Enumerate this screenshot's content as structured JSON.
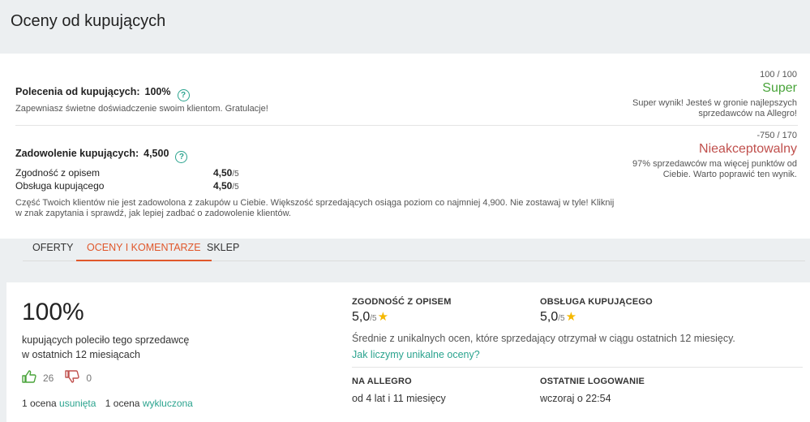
{
  "page_title": "Oceny od kupujących",
  "recommendations": {
    "label": "Polecenia od kupujących",
    "colon": ":",
    "value": "100%",
    "help": "?",
    "description": "Zapewniasz świetne doświadczenie swoim klientom. Gratulacje!",
    "score": "100 / 100",
    "verdict": "Super",
    "verdict_desc": "Super wynik! Jesteś w gronie najlepszych sprzedawców na Allegro!",
    "verdict_color": "#49a43a"
  },
  "satisfaction": {
    "label": "Zadowolenie kupujących",
    "colon": ":",
    "value": "4,500",
    "help": "?",
    "rows": [
      {
        "label": "Zgodność z opisem",
        "value": "4,50",
        "max": "/5"
      },
      {
        "label": "Obsługa kupującego",
        "value": "4,50",
        "max": "/5"
      }
    ],
    "warning": "Część Twoich klientów nie jest zadowolona z zakupów u Ciebie. Większość sprzedających osiąga poziom co najmniej 4,900. Nie zostawaj w tyle! Kliknij w znak zapytania i sprawdź, jak lepiej zadbać o zadowolenie klientów.",
    "score": "-750 / 170",
    "verdict": "Nieakceptowalny",
    "verdict_desc": "97% sprzedawców ma więcej punktów od Ciebie. Warto poprawić ten wynik.",
    "verdict_color": "#c0504d"
  },
  "tabs": [
    "OFERTY",
    "OCENY I KOMENTARZE",
    "SKLEP"
  ],
  "active_tab": "OCENY I KOMENTARZE",
  "summary": {
    "percent": "100%",
    "text_line1": "kupujących poleciło tego sprzedawcę",
    "text_line2": "w ostatnich 12 miesiącach",
    "positive_count": "26",
    "negative_count": "0",
    "removed_prefix": "1 ocena",
    "removed_link": "usunięta",
    "excluded_prefix": "1 ocena",
    "excluded_link": "wykluczona"
  },
  "ratings": {
    "description_heading": "ZGODNOŚĆ Z OPISEM",
    "description_score": "5,0",
    "description_max": "/5",
    "service_heading": "OBSŁUGA KUPUJĄCEGO",
    "service_score": "5,0",
    "service_max": "/5",
    "note": "Średnie z unikalnych ocen, które sprzedający otrzymał w ciągu ostatnich 12 miesięcy.",
    "how_link": "Jak liczymy unikalne oceny?",
    "star": "★"
  },
  "info": {
    "on_allegro_heading": "NA ALLEGRO",
    "on_allegro_value": "od 4 lat i 11 miesięcy",
    "last_login_heading": "OSTATNIE LOGOWANIE",
    "last_login_value": "wczoraj o 22:54"
  },
  "colors": {
    "accent": "#e0572b",
    "link": "#2aa38e",
    "star": "#f5b800"
  }
}
